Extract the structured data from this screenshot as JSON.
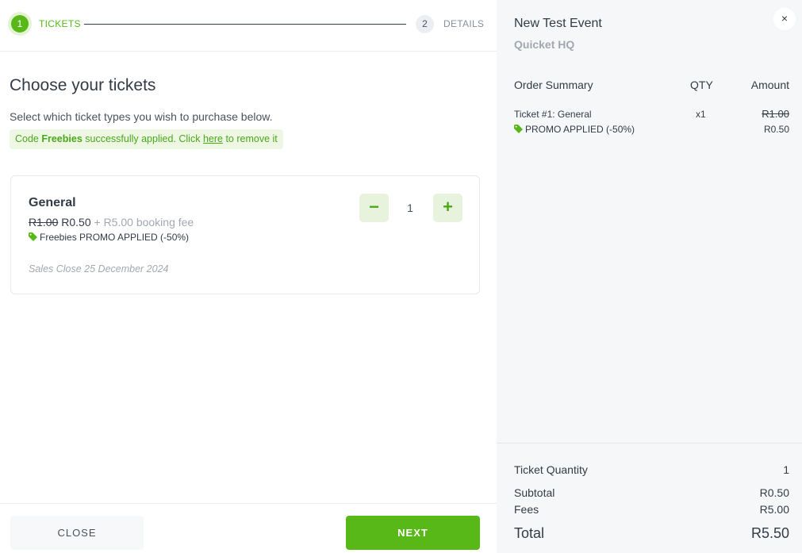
{
  "stepper": {
    "step1": {
      "number": "1",
      "label": "TICKETS"
    },
    "step2": {
      "number": "2",
      "label": "DETAILS"
    }
  },
  "main": {
    "title": "Choose your tickets",
    "subtitle": "Select which ticket types you wish to purchase below.",
    "promo_note": {
      "prefix": "Code ",
      "code": "Freebies",
      "middle": " successfully applied. Click ",
      "link": "here",
      "suffix": " to remove it"
    }
  },
  "ticket": {
    "name": "General",
    "old_price": "R1.00",
    "new_price": "R0.50",
    "fee_text": "+ R5.00 booking fee",
    "promo_text": "Freebies PROMO APPLIED (-50%)",
    "sales_close": "Sales Close 25 December 2024",
    "quantity": "1",
    "minus_label": "−",
    "plus_label": "+"
  },
  "footer": {
    "close_label": "CLOSE",
    "next_label": "NEXT"
  },
  "summary": {
    "close_icon": "×",
    "event_title": "New Test Event",
    "venue": "Quicket HQ",
    "headers": {
      "item": "Order Summary",
      "qty": "QTY",
      "amount": "Amount"
    },
    "line": {
      "item": "Ticket #1: General",
      "qty": "x1",
      "old_amount": "R1.00",
      "promo": "PROMO APPLIED (-50%)",
      "new_amount": "R0.50"
    },
    "totals": {
      "quantity_label": "Ticket Quantity",
      "quantity_value": "1",
      "subtotal_label": "Subtotal",
      "subtotal_value": "R0.50",
      "fees_label": "Fees",
      "fees_value": "R5.00",
      "total_label": "Total",
      "total_value": "R5.50"
    }
  },
  "colors": {
    "accent": "#58b818",
    "accent_light": "#e7f3dc",
    "text": "#333b46",
    "muted": "#a3a8b0"
  },
  "icons": {
    "promo_tag": "tag-icon",
    "close": "close-icon"
  }
}
